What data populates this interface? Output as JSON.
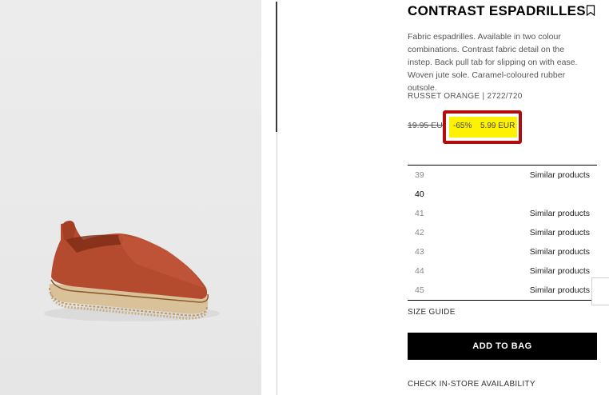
{
  "product": {
    "title": "CONTRAST ESPADRILLES",
    "description": "Fabric espadrilles. Available in two colour combinations. Contrast fabric detail on the instep. Back pull tab for slipping on with ease. Woven jute sole. Caramel-coloured rubber outsole.",
    "color_ref": "RUSSET ORANGE | 2722/720",
    "old_price": "19.95 EUR",
    "discount": "-65%",
    "new_price": "5.99 EUR",
    "image_icon": "espadrille-product-image"
  },
  "sizes": [
    {
      "size": "39",
      "status": "Similar products",
      "available": false
    },
    {
      "size": "40",
      "status": "",
      "available": true
    },
    {
      "size": "41",
      "status": "Similar products",
      "available": false
    },
    {
      "size": "42",
      "status": "Similar products",
      "available": false
    },
    {
      "size": "43",
      "status": "Similar products",
      "available": false
    },
    {
      "size": "44",
      "status": "Similar products",
      "available": false
    },
    {
      "size": "45",
      "status": "Similar products",
      "available": false
    }
  ],
  "actions": {
    "size_guide": "SIZE GUIDE",
    "add_to_bag": "ADD TO BAG",
    "check_store": "CHECK IN-STORE AVAILABILITY"
  },
  "icons": {
    "bookmark": "bookmark-icon"
  },
  "colors": {
    "highlight": "#fff200",
    "price_box_border": "#b30c0c",
    "button_bg": "#000000",
    "shoe": "#b44a2e"
  }
}
